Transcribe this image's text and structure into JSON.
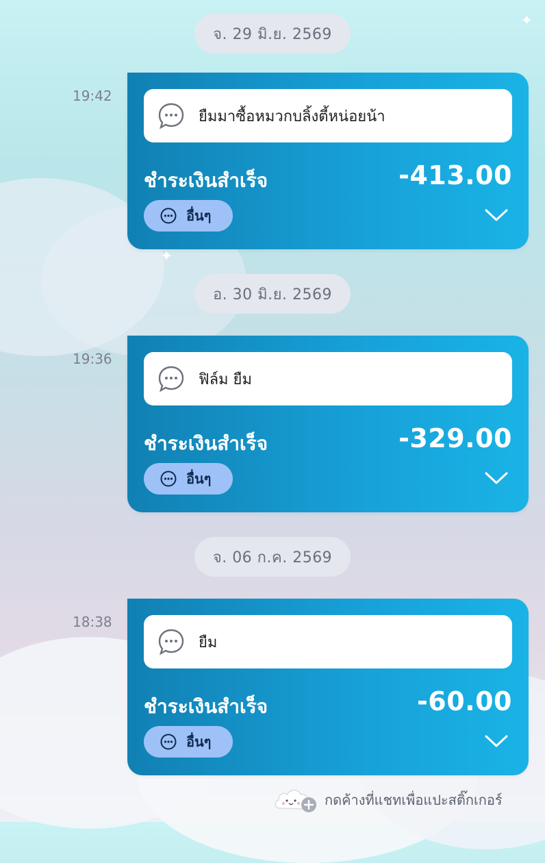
{
  "messages": [
    {
      "date": "จ. 29 มิ.ย. 2569",
      "time": "19:42",
      "note": "ยืมมาซื้อหมวกบลิ้งตี้หน่อยน้า",
      "status": "ชำระเงินสำเร็จ",
      "amount": "-413.00",
      "category": "อื่นๆ"
    },
    {
      "date": "อ. 30 มิ.ย. 2569",
      "time": "19:36",
      "note": "ฟิล์ม ยืม",
      "status": "ชำระเงินสำเร็จ",
      "amount": "-329.00",
      "category": "อื่นๆ"
    },
    {
      "date": "จ. 06 ก.ค. 2569",
      "time": "18:38",
      "note": "ยืม",
      "status": "ชำระเงินสำเร็จ",
      "amount": "-60.00",
      "category": "อื่นๆ"
    }
  ],
  "footer": {
    "sticker_hint": "กดค้างที่แชทเพื่อแปะสติ๊กเกอร์",
    "sticker_icon": "cloud-sticker-add-icon"
  },
  "colors": {
    "card_start": "#1180b3",
    "card_end": "#1ab3e6",
    "category_pill": "#9ec2f7",
    "date_pill": "#e4e7ee"
  }
}
